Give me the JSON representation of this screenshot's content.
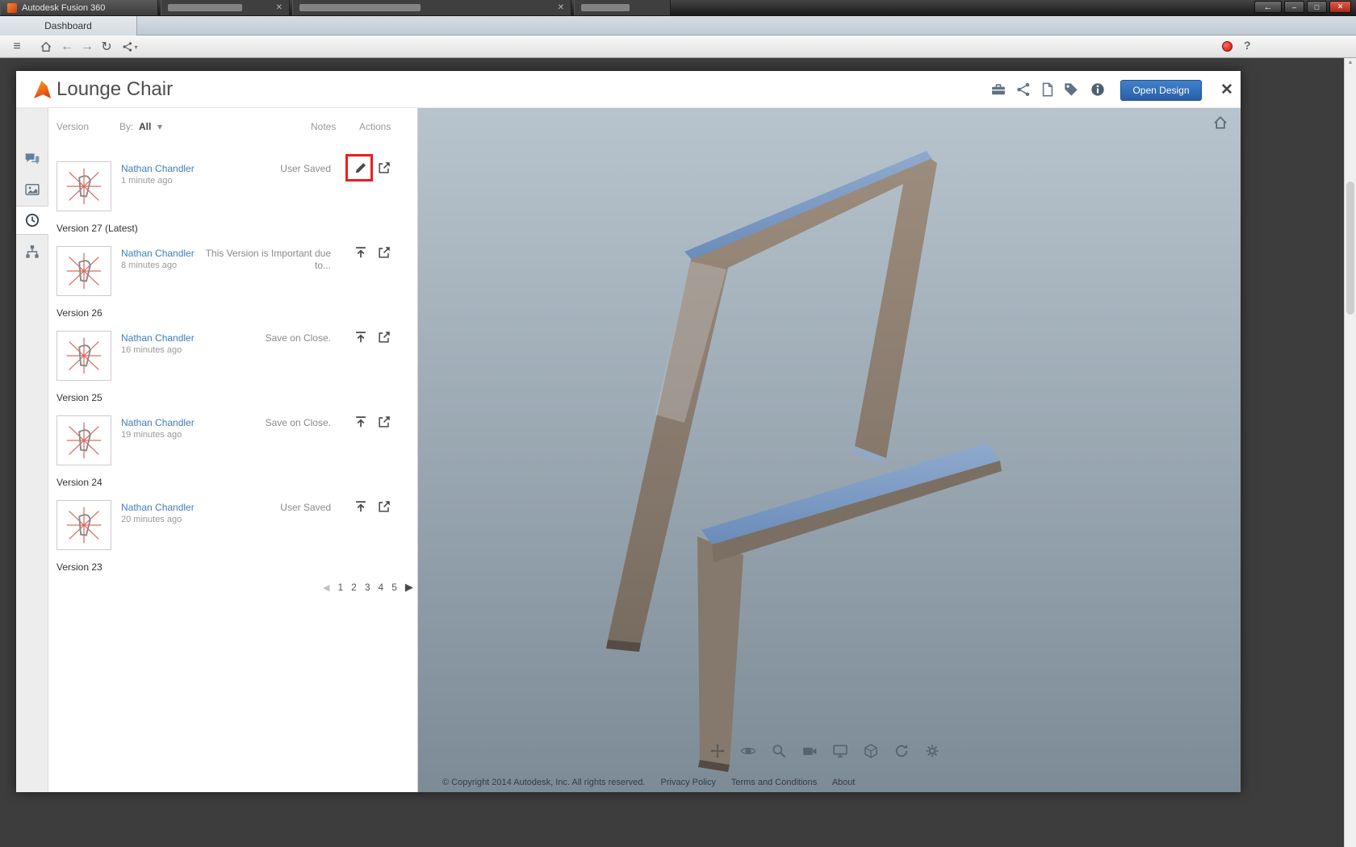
{
  "colors": {
    "accent_blue": "#2e66a4",
    "highlight_red": "#ee1c1c",
    "link_blue": "#3d7dbd"
  },
  "browser": {
    "window_title": "Autodesk Fusion 360",
    "dashboard_tab_label": "Dashboard"
  },
  "icons": {
    "hamburger": "≡",
    "back": "←",
    "forward": "→",
    "refresh": "↻",
    "caret_down": "▾",
    "help": "?",
    "minimize": "–",
    "maximize": "□",
    "close": "✕",
    "tab_close": "✕",
    "titlebar_back": "←",
    "scroll_up": "▲",
    "pagination_prev": "◀",
    "pagination_next": "▶"
  },
  "modal": {
    "title": "Lounge Chair",
    "open_design_label": "Open Design"
  },
  "version_panel": {
    "header": {
      "version": "Version",
      "by": "By:",
      "filter": "All",
      "notes": "Notes",
      "actions": "Actions"
    },
    "versions": [
      {
        "author": "Nathan Chandler",
        "time": "1 minute ago",
        "note": "User Saved",
        "label": "Version 27 (Latest)"
      },
      {
        "author": "Nathan Chandler",
        "time": "8 minutes ago",
        "note": "This Version is Important due to...",
        "label": "Version 26"
      },
      {
        "author": "Nathan Chandler",
        "time": "16 minutes ago",
        "note": "Save on Close.",
        "label": "Version 25"
      },
      {
        "author": "Nathan Chandler",
        "time": "19 minutes ago",
        "note": "Save on Close.",
        "label": "Version 24"
      },
      {
        "author": "Nathan Chandler",
        "time": "20 minutes ago",
        "note": "User Saved",
        "label": "Version 23"
      }
    ],
    "pagination": [
      "1",
      "2",
      "3",
      "4",
      "5"
    ]
  },
  "viewport_footer": {
    "copyright": "© Copyright 2014 Autodesk, Inc. All rights reserved.",
    "links": [
      "Privacy Policy",
      "Terms and Conditions",
      "About"
    ]
  }
}
